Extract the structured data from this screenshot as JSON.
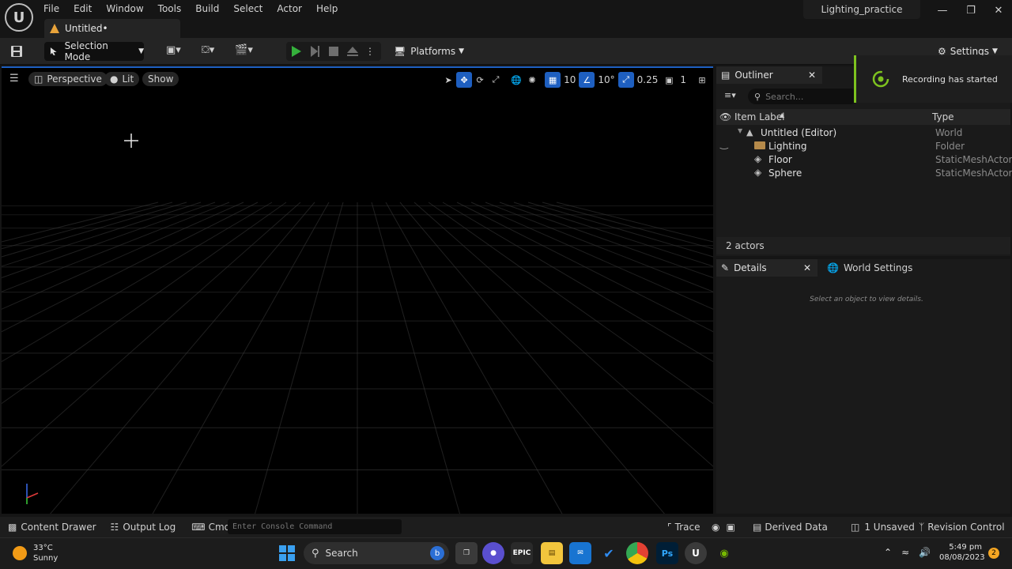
{
  "app": {
    "menu": [
      "File",
      "Edit",
      "Window",
      "Tools",
      "Build",
      "Select",
      "Actor",
      "Help"
    ],
    "doc_tab": "Untitled•",
    "project_name": "Lighting_practice"
  },
  "toolbar": {
    "selection_mode": "Selection Mode",
    "platforms": "Platforms",
    "settings": "Settings"
  },
  "viewport": {
    "perspective": "Perspective",
    "lit": "Lit",
    "show": "Show",
    "grid_snap": "10",
    "rotation_snap": "10°",
    "scale_snap": "0.25",
    "camera_speed": "1"
  },
  "outliner": {
    "tab": "Outliner",
    "search_placeholder": "Search...",
    "col_label": "Item Label",
    "col_type": "Type",
    "rows": [
      {
        "label": "Untitled (Editor)",
        "type": "World"
      },
      {
        "label": "Lighting",
        "type": "Folder"
      },
      {
        "label": "Floor",
        "type": "StaticMeshActor"
      },
      {
        "label": "Sphere",
        "type": "StaticMeshActor"
      }
    ],
    "count": "2 actors"
  },
  "details": {
    "tab": "Details",
    "world_tab": "World Settings",
    "empty": "Select an object to view details."
  },
  "toast": {
    "message": "Recording has started"
  },
  "statusbar": {
    "content_drawer": "Content Drawer",
    "output_log": "Output Log",
    "cmd": "Cmd",
    "console_placeholder": "Enter Console Command",
    "trace": "Trace",
    "derived_data": "Derived Data",
    "unsaved": "1 Unsaved",
    "revision_control": "Revision Control"
  },
  "taskbar": {
    "temp": "33°C",
    "weather": "Sunny",
    "search": "Search",
    "time": "5:49 pm",
    "date": "08/08/2023",
    "notifications": "2"
  },
  "colors": {
    "accent": "#1e5fc0",
    "toast_bar": "#7ec31f"
  }
}
